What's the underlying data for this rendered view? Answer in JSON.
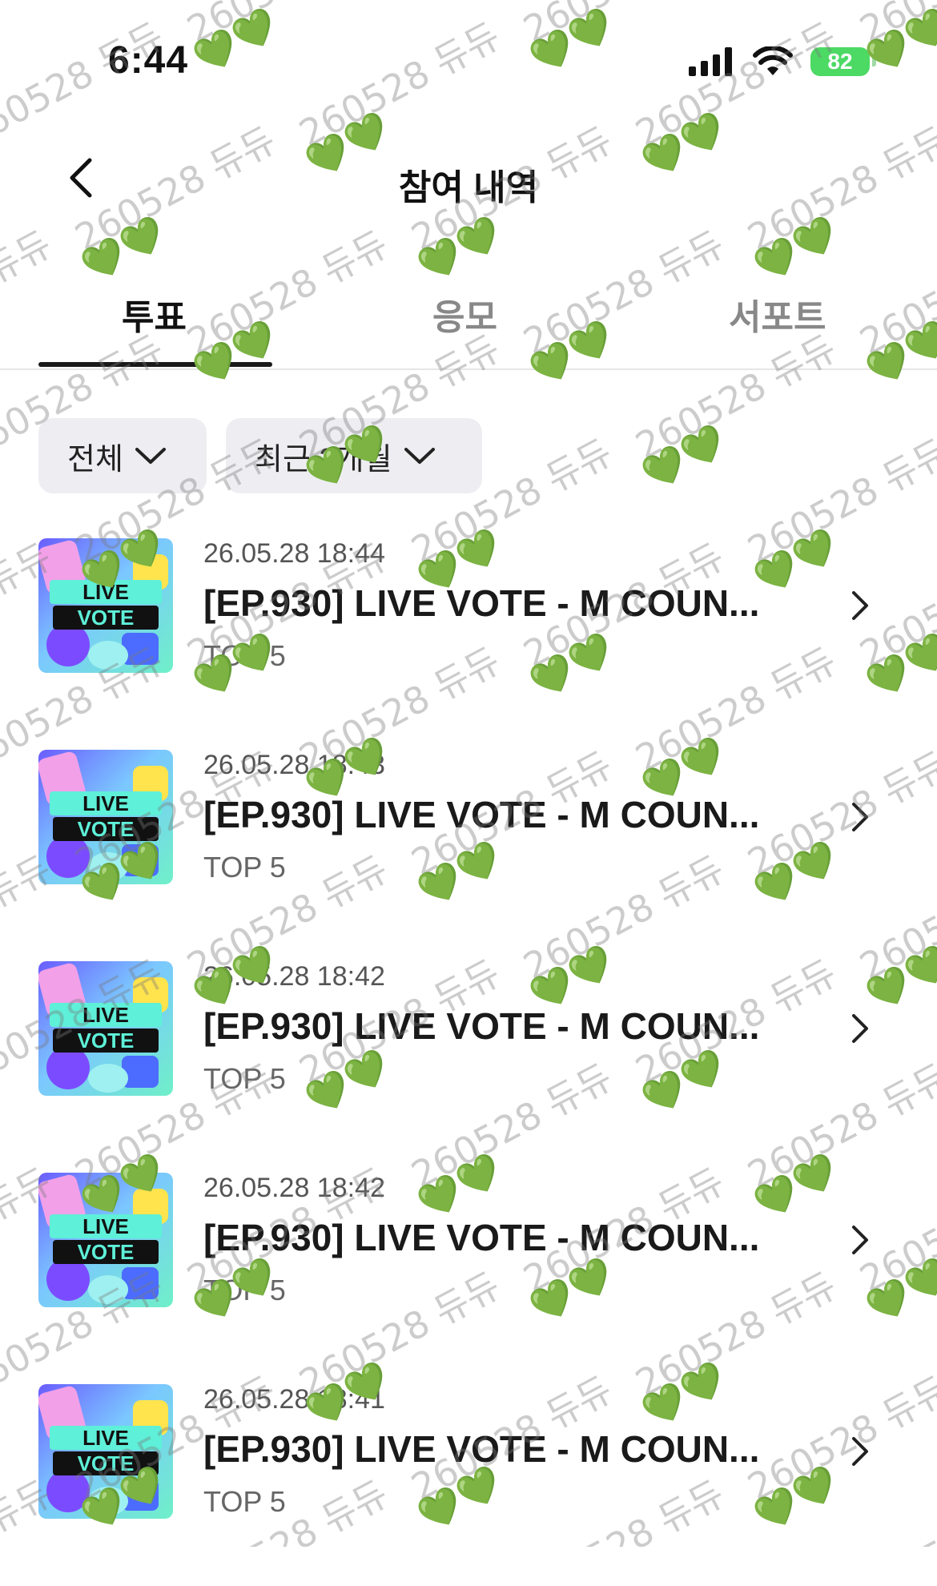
{
  "status_bar": {
    "time": "6:44",
    "battery": "82"
  },
  "nav": {
    "title": "참여 내역"
  },
  "tabs": [
    {
      "label": "투표",
      "active": true
    },
    {
      "label": "응모",
      "active": false
    },
    {
      "label": "서포트",
      "active": false
    }
  ],
  "filters": {
    "all_label": "전체",
    "period_label": "최근 3개월"
  },
  "items": [
    {
      "date": "26.05.28 18:44",
      "title": "[EP.930] LIVE VOTE - M COUN...",
      "sub": "TOP 5",
      "thumb_line1": "LIVE",
      "thumb_line2": "VOTE"
    },
    {
      "date": "26.05.28 18:43",
      "title": "[EP.930] LIVE VOTE - M COUN...",
      "sub": "TOP 5",
      "thumb_line1": "LIVE",
      "thumb_line2": "VOTE"
    },
    {
      "date": "26.05.28 18:42",
      "title": "[EP.930] LIVE VOTE - M COUN...",
      "sub": "TOP 5",
      "thumb_line1": "LIVE",
      "thumb_line2": "VOTE"
    },
    {
      "date": "26.05.28 18:42",
      "title": "[EP.930] LIVE VOTE - M COUN...",
      "sub": "TOP 5",
      "thumb_line1": "LIVE",
      "thumb_line2": "VOTE"
    },
    {
      "date": "26.05.28 18:41",
      "title": "[EP.930] LIVE VOTE - M COUN...",
      "sub": "TOP 5",
      "thumb_line1": "LIVE",
      "thumb_line2": "VOTE"
    }
  ],
  "watermark": {
    "text": "260528 듀듀",
    "hearts": "💚💚"
  },
  "colors": {
    "accent": "#1a1a1a",
    "chip_bg": "#eeeef2",
    "battery": "#4cd964",
    "heart": "#35c84a"
  }
}
